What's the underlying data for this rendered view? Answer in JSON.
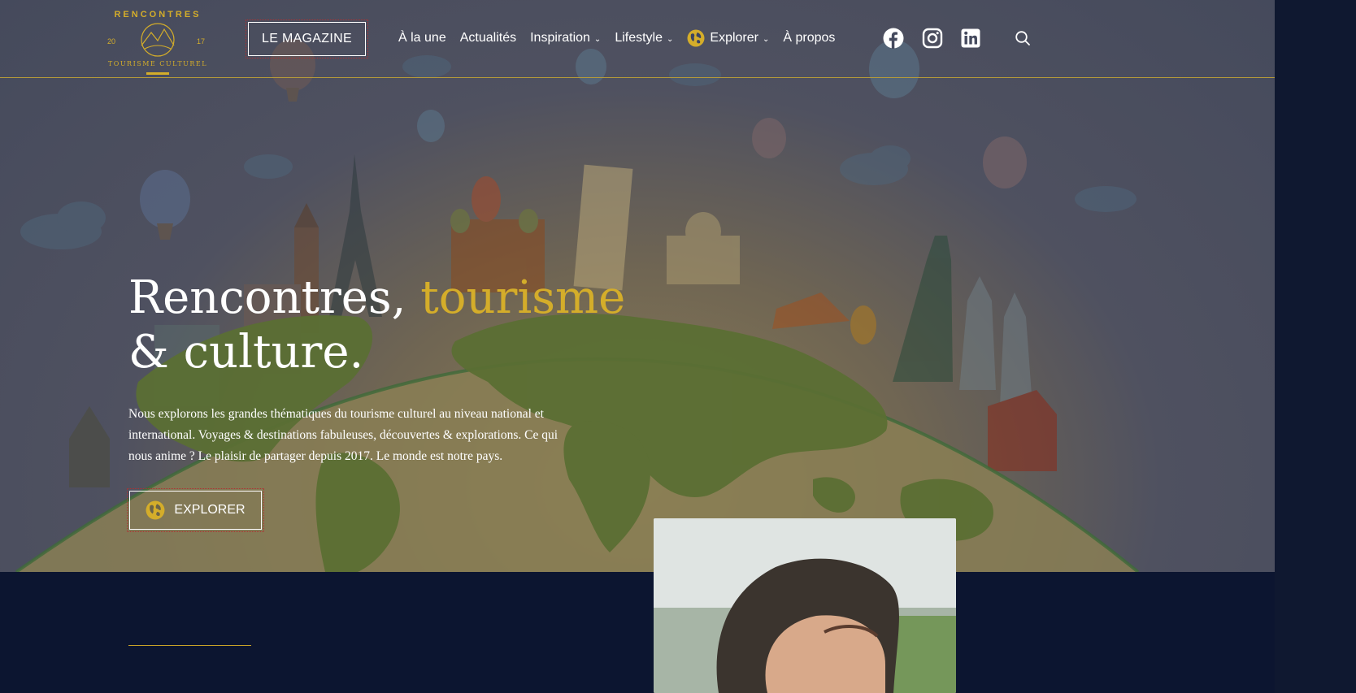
{
  "brand": {
    "logo_top": "RENCONTRES",
    "logo_bottom": "TOURISME CULTUREL",
    "logo_year_left": "20",
    "logo_year_right": "17",
    "accent_color": "#d4ad2a"
  },
  "header": {
    "magazine_button": "LE MAGAZINE",
    "nav": [
      {
        "label": "À la une",
        "dropdown": false
      },
      {
        "label": "Actualités",
        "dropdown": false
      },
      {
        "label": "Inspiration",
        "dropdown": true
      },
      {
        "label": "Lifestyle",
        "dropdown": true
      },
      {
        "label": "Explorer",
        "dropdown": true,
        "icon": "globe-icon"
      },
      {
        "label": "À propos",
        "dropdown": false
      }
    ],
    "social": [
      "facebook-icon",
      "instagram-icon",
      "linkedin-icon"
    ],
    "search_icon": "search-icon"
  },
  "hero": {
    "title_part1": "Rencontres, ",
    "title_accent": "tourisme",
    "title_part2": "& culture.",
    "description": "Nous explorons les grandes thématiques du tourisme culturel au niveau national et international. Voyages & destinations fabuleuses, découvertes & explorations. Ce qui nous anime ? Le plaisir de partager depuis 2017. Le monde est notre pays.",
    "cta_label": "EXPLORER",
    "cta_icon": "globe-icon"
  }
}
